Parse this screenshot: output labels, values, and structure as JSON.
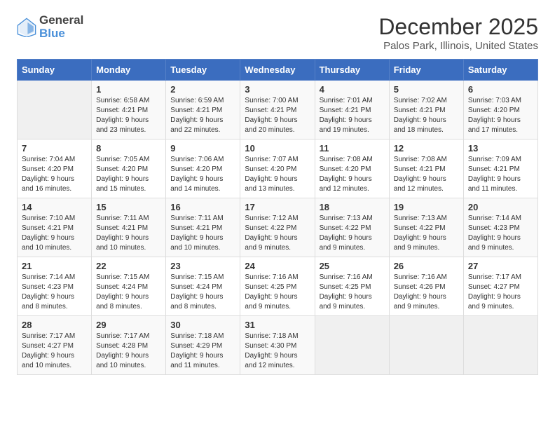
{
  "logo": {
    "text_general": "General",
    "text_blue": "Blue"
  },
  "calendar": {
    "title": "December 2025",
    "subtitle": "Palos Park, Illinois, United States"
  },
  "days_of_week": [
    "Sunday",
    "Monday",
    "Tuesday",
    "Wednesday",
    "Thursday",
    "Friday",
    "Saturday"
  ],
  "weeks": [
    [
      {
        "day": "",
        "info": ""
      },
      {
        "day": "1",
        "info": "Sunrise: 6:58 AM\nSunset: 4:21 PM\nDaylight: 9 hours\nand 23 minutes."
      },
      {
        "day": "2",
        "info": "Sunrise: 6:59 AM\nSunset: 4:21 PM\nDaylight: 9 hours\nand 22 minutes."
      },
      {
        "day": "3",
        "info": "Sunrise: 7:00 AM\nSunset: 4:21 PM\nDaylight: 9 hours\nand 20 minutes."
      },
      {
        "day": "4",
        "info": "Sunrise: 7:01 AM\nSunset: 4:21 PM\nDaylight: 9 hours\nand 19 minutes."
      },
      {
        "day": "5",
        "info": "Sunrise: 7:02 AM\nSunset: 4:21 PM\nDaylight: 9 hours\nand 18 minutes."
      },
      {
        "day": "6",
        "info": "Sunrise: 7:03 AM\nSunset: 4:20 PM\nDaylight: 9 hours\nand 17 minutes."
      }
    ],
    [
      {
        "day": "7",
        "info": "Sunrise: 7:04 AM\nSunset: 4:20 PM\nDaylight: 9 hours\nand 16 minutes."
      },
      {
        "day": "8",
        "info": "Sunrise: 7:05 AM\nSunset: 4:20 PM\nDaylight: 9 hours\nand 15 minutes."
      },
      {
        "day": "9",
        "info": "Sunrise: 7:06 AM\nSunset: 4:20 PM\nDaylight: 9 hours\nand 14 minutes."
      },
      {
        "day": "10",
        "info": "Sunrise: 7:07 AM\nSunset: 4:20 PM\nDaylight: 9 hours\nand 13 minutes."
      },
      {
        "day": "11",
        "info": "Sunrise: 7:08 AM\nSunset: 4:20 PM\nDaylight: 9 hours\nand 12 minutes."
      },
      {
        "day": "12",
        "info": "Sunrise: 7:08 AM\nSunset: 4:21 PM\nDaylight: 9 hours\nand 12 minutes."
      },
      {
        "day": "13",
        "info": "Sunrise: 7:09 AM\nSunset: 4:21 PM\nDaylight: 9 hours\nand 11 minutes."
      }
    ],
    [
      {
        "day": "14",
        "info": "Sunrise: 7:10 AM\nSunset: 4:21 PM\nDaylight: 9 hours\nand 10 minutes."
      },
      {
        "day": "15",
        "info": "Sunrise: 7:11 AM\nSunset: 4:21 PM\nDaylight: 9 hours\nand 10 minutes."
      },
      {
        "day": "16",
        "info": "Sunrise: 7:11 AM\nSunset: 4:21 PM\nDaylight: 9 hours\nand 10 minutes."
      },
      {
        "day": "17",
        "info": "Sunrise: 7:12 AM\nSunset: 4:22 PM\nDaylight: 9 hours\nand 9 minutes."
      },
      {
        "day": "18",
        "info": "Sunrise: 7:13 AM\nSunset: 4:22 PM\nDaylight: 9 hours\nand 9 minutes."
      },
      {
        "day": "19",
        "info": "Sunrise: 7:13 AM\nSunset: 4:22 PM\nDaylight: 9 hours\nand 9 minutes."
      },
      {
        "day": "20",
        "info": "Sunrise: 7:14 AM\nSunset: 4:23 PM\nDaylight: 9 hours\nand 9 minutes."
      }
    ],
    [
      {
        "day": "21",
        "info": "Sunrise: 7:14 AM\nSunset: 4:23 PM\nDaylight: 9 hours\nand 8 minutes."
      },
      {
        "day": "22",
        "info": "Sunrise: 7:15 AM\nSunset: 4:24 PM\nDaylight: 9 hours\nand 8 minutes."
      },
      {
        "day": "23",
        "info": "Sunrise: 7:15 AM\nSunset: 4:24 PM\nDaylight: 9 hours\nand 8 minutes."
      },
      {
        "day": "24",
        "info": "Sunrise: 7:16 AM\nSunset: 4:25 PM\nDaylight: 9 hours\nand 9 minutes."
      },
      {
        "day": "25",
        "info": "Sunrise: 7:16 AM\nSunset: 4:25 PM\nDaylight: 9 hours\nand 9 minutes."
      },
      {
        "day": "26",
        "info": "Sunrise: 7:16 AM\nSunset: 4:26 PM\nDaylight: 9 hours\nand 9 minutes."
      },
      {
        "day": "27",
        "info": "Sunrise: 7:17 AM\nSunset: 4:27 PM\nDaylight: 9 hours\nand 9 minutes."
      }
    ],
    [
      {
        "day": "28",
        "info": "Sunrise: 7:17 AM\nSunset: 4:27 PM\nDaylight: 9 hours\nand 10 minutes."
      },
      {
        "day": "29",
        "info": "Sunrise: 7:17 AM\nSunset: 4:28 PM\nDaylight: 9 hours\nand 10 minutes."
      },
      {
        "day": "30",
        "info": "Sunrise: 7:18 AM\nSunset: 4:29 PM\nDaylight: 9 hours\nand 11 minutes."
      },
      {
        "day": "31",
        "info": "Sunrise: 7:18 AM\nSunset: 4:30 PM\nDaylight: 9 hours\nand 12 minutes."
      },
      {
        "day": "",
        "info": ""
      },
      {
        "day": "",
        "info": ""
      },
      {
        "day": "",
        "info": ""
      }
    ]
  ]
}
